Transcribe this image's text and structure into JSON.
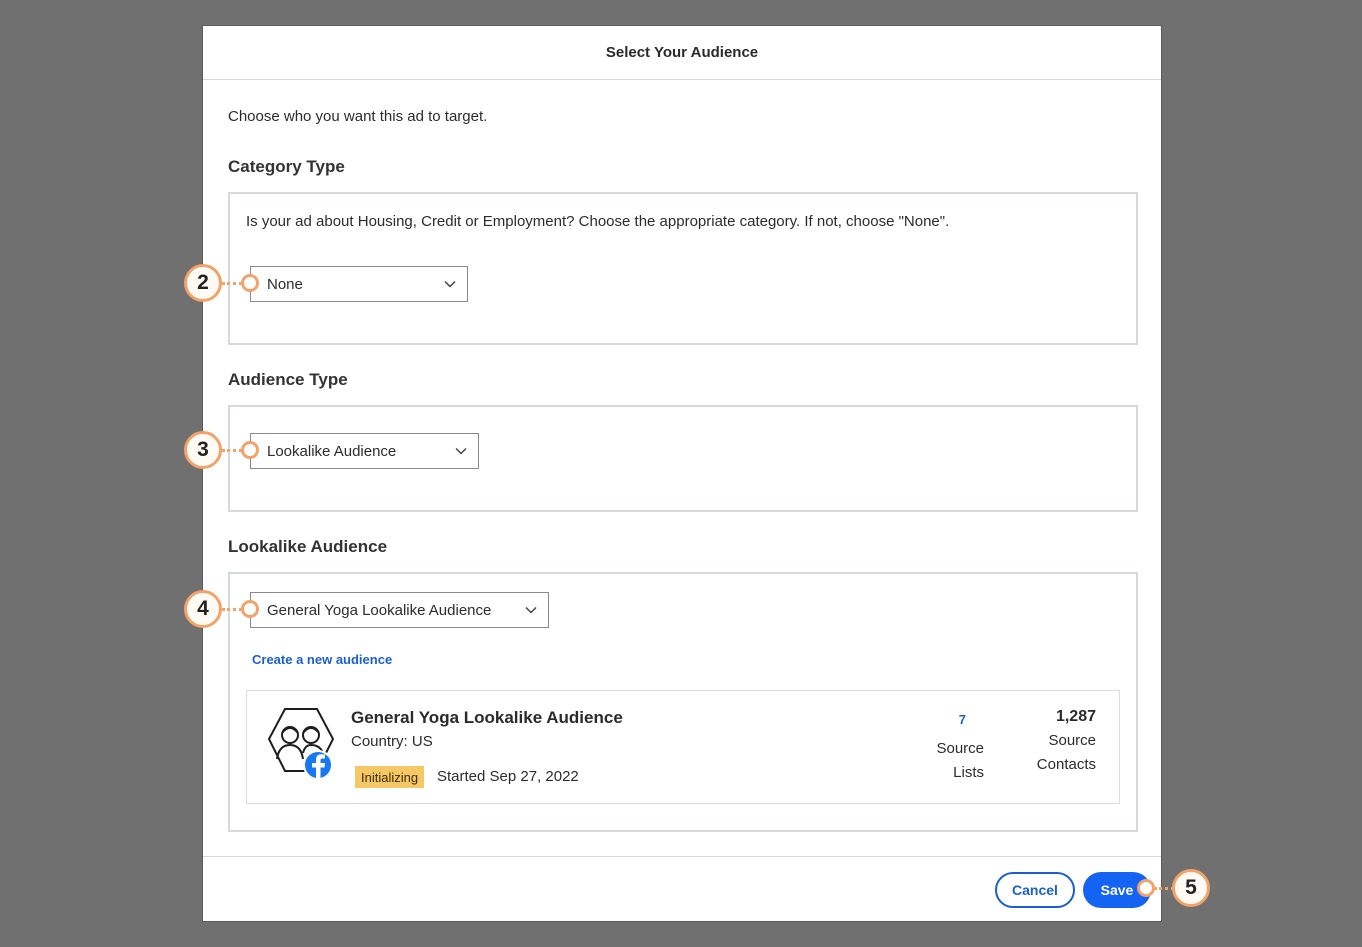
{
  "modal": {
    "title": "Select Your Audience",
    "intro": "Choose who you want this ad to target."
  },
  "category": {
    "title": "Category Type",
    "description": "Is your ad about Housing, Credit or Employment? Choose the appropriate category. If not, choose \"None\".",
    "selected": "None"
  },
  "audience_type": {
    "title": "Audience Type",
    "selected": "Lookalike Audience"
  },
  "lookalike": {
    "title": "Lookalike Audience",
    "selected": "General Yoga Lookalike Audience",
    "create_link": "Create a new audience",
    "card": {
      "name": "General Yoga Lookalike Audience",
      "country": "Country: US",
      "status_badge": "Initializing",
      "started": "Started Sep 27, 2022",
      "source_lists_count": "7",
      "source_lists_label_1": "Source",
      "source_lists_label_2": "Lists",
      "source_contacts_count": "1,287",
      "source_contacts_label_1": "Source",
      "source_contacts_label_2": "Contacts"
    }
  },
  "footer": {
    "cancel_label": "Cancel",
    "save_label": "Save"
  },
  "callouts": [
    "2",
    "3",
    "4",
    "5"
  ],
  "icons": {
    "audience": "lookalike-audience-hexagon-icon",
    "network": "facebook-icon",
    "dropdown": "chevron-down-icon"
  },
  "colors": {
    "accent": "#1463f3",
    "link": "#1a5fd0",
    "badge": "#f6c765",
    "callout": "#f2a36a",
    "overlay": "#707070"
  }
}
